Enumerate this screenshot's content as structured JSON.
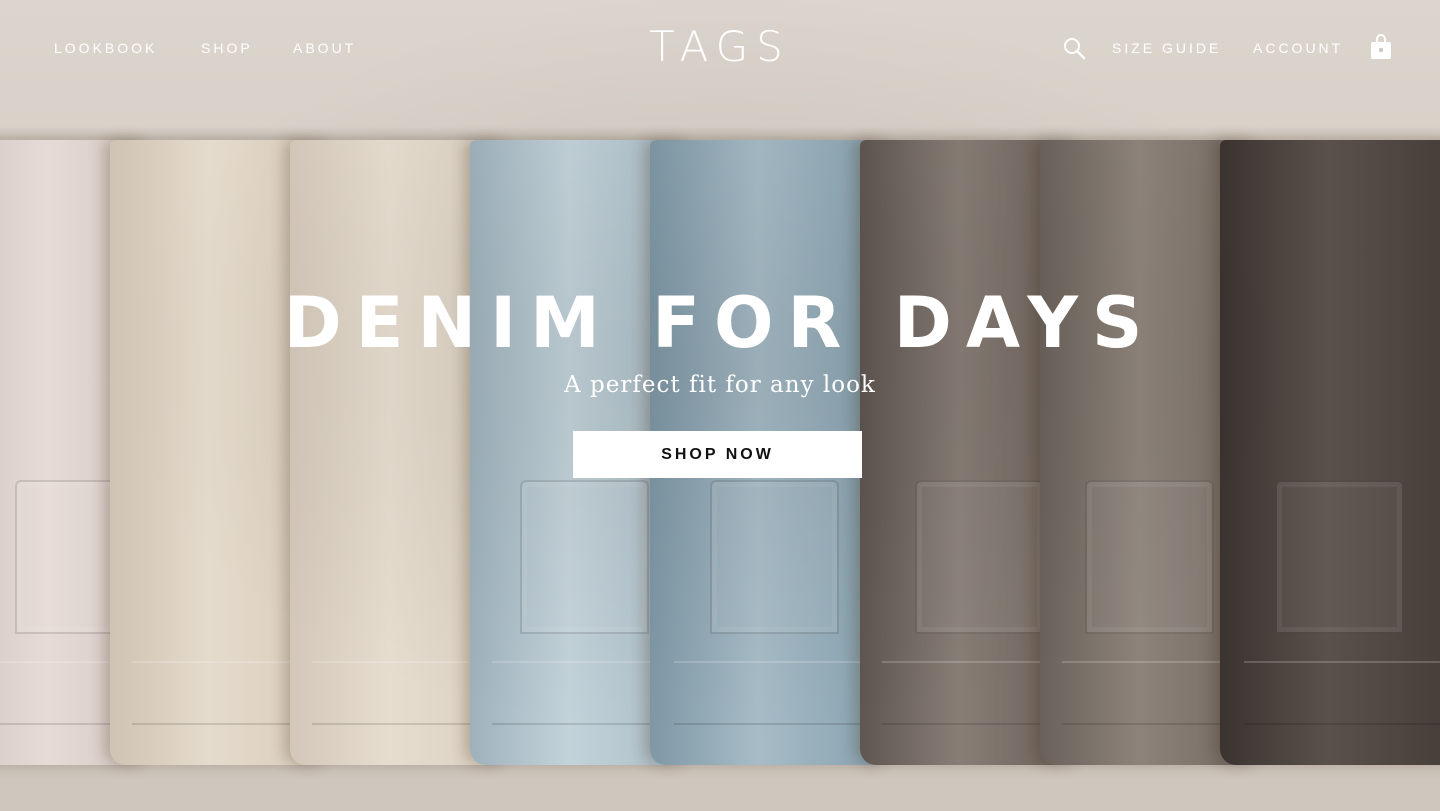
{
  "header": {
    "nav_left": [
      "LOOKBOOK",
      "SHOP",
      "ABOUT"
    ],
    "logo": "TAGS",
    "nav_right": [
      "SIZE GUIDE",
      "ACCOUNT"
    ],
    "icons": {
      "search": "search-icon",
      "bag": "shopping-bag-icon"
    }
  },
  "hero": {
    "headline": "DENIM FOR DAYS",
    "subheadline": "A perfect fit for any look",
    "cta_label": "SHOP NOW",
    "image": "folded-denim-jeans-on-rod"
  },
  "colors": {
    "text": "#ffffff",
    "cta_bg": "#ffffff",
    "cta_text": "#111111"
  }
}
